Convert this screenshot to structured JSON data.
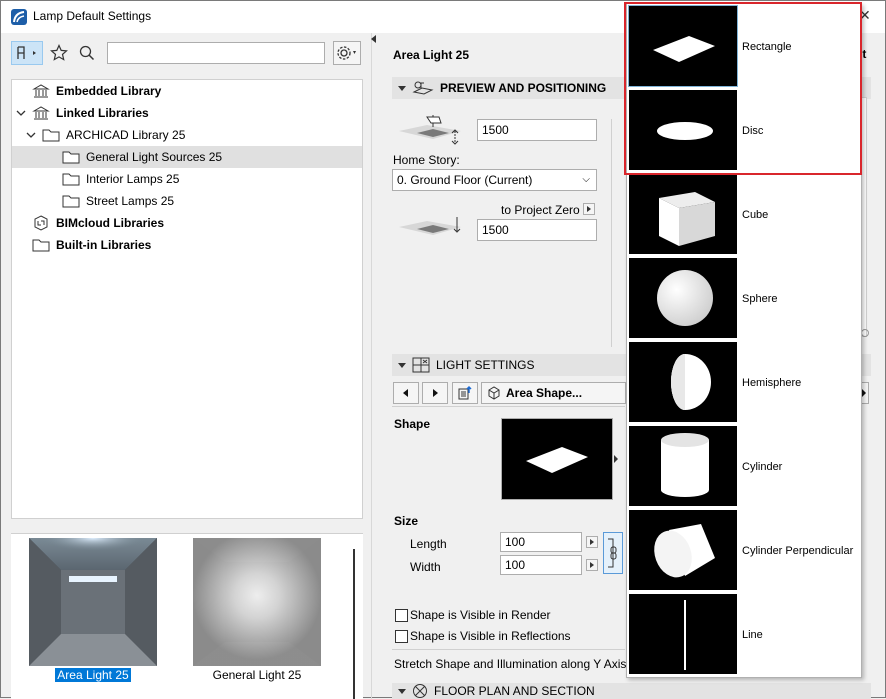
{
  "window": {
    "title": "Lamp Default Settings"
  },
  "left": {
    "tree": [
      {
        "label": "Embedded Library",
        "bold": true,
        "indent": 0,
        "chevron": "",
        "icon": "library-icon"
      },
      {
        "label": "Linked Libraries",
        "bold": true,
        "indent": 0,
        "chevron": "down",
        "icon": "library-icon"
      },
      {
        "label": "ARCHICAD Library 25",
        "bold": false,
        "indent": 1,
        "chevron": "down",
        "icon": "folder-icon"
      },
      {
        "label": "General Light Sources 25",
        "bold": false,
        "indent": 2,
        "chevron": "",
        "icon": "folder-icon",
        "selected": true
      },
      {
        "label": "Interior Lamps 25",
        "bold": false,
        "indent": 2,
        "chevron": "",
        "icon": "folder-icon"
      },
      {
        "label": "Street Lamps 25",
        "bold": false,
        "indent": 2,
        "chevron": "",
        "icon": "folder-icon"
      },
      {
        "label": "BIMcloud Libraries",
        "bold": true,
        "indent": 0,
        "chevron": "",
        "icon": "bimcloud-icon"
      },
      {
        "label": "Built-in Libraries",
        "bold": true,
        "indent": 0,
        "chevron": "",
        "icon": "folder-icon"
      }
    ],
    "thumbs": [
      {
        "label": "Area Light 25",
        "selected": true
      },
      {
        "label": "General Light 25",
        "selected": false
      }
    ]
  },
  "right": {
    "lamp_name": "Area Light 25",
    "preview": {
      "header": "PREVIEW AND POSITIONING",
      "elevation_value": "1500",
      "home_story_label": "Home Story:",
      "home_story_value": "0. Ground Floor (Current)",
      "to_project_zero_label": "to Project Zero",
      "project_zero_value": "1500"
    },
    "light": {
      "header": "LIGHT SETTINGS",
      "page_button": "Area Shape...",
      "shape_label": "Shape",
      "size_label": "Size",
      "length_label": "Length",
      "length_value": "100",
      "width_label": "Width",
      "width_value": "100",
      "check_render": "Shape is Visible in Render",
      "check_reflections": "Shape is Visible in Reflections",
      "stretch_label": "Stretch Shape and Illumination along Y Axis"
    },
    "floor_plan": {
      "header": "FLOOR PLAN AND SECTION"
    },
    "edge_text": "lt"
  },
  "popup": {
    "items": [
      "Rectangle",
      "Disc",
      "Cube",
      "Sphere",
      "Hemisphere",
      "Cylinder",
      "Cylinder Perpendicular",
      "Line"
    ],
    "selected_index": 0
  },
  "colors": {
    "highlight": "#d9262c",
    "selection": "#0078d7",
    "section_header": "#e3e3e3"
  }
}
